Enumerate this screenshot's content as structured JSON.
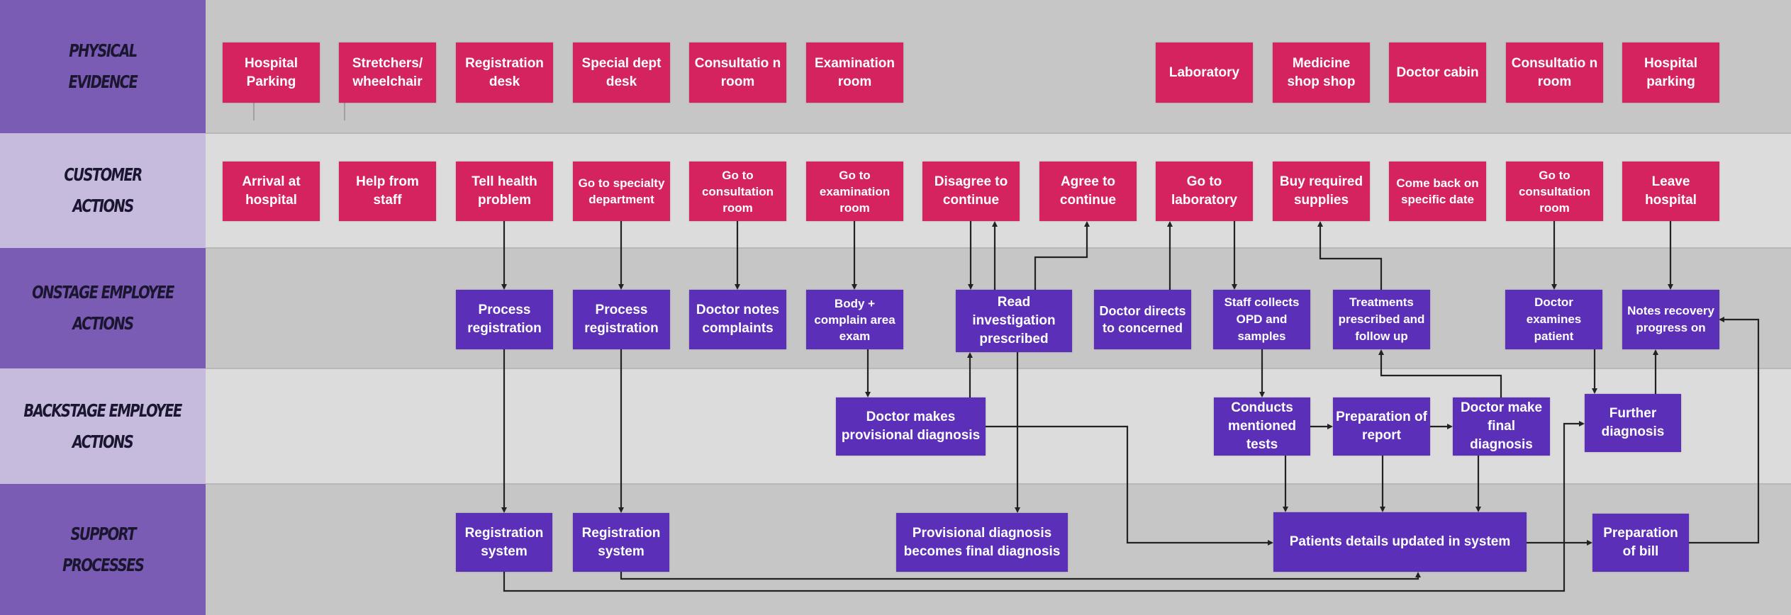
{
  "diagram": {
    "type": "service-blueprint",
    "colors": {
      "customer_facing_box": "#d4235f",
      "employee_process_box": "#5b2fb8",
      "lane_label_dark": "#7b5cb4",
      "lane_label_light": "#c6bbdc",
      "connector": "#222222"
    },
    "lanes": [
      {
        "id": "physical",
        "label": "Physical\nEvidence"
      },
      {
        "id": "customer",
        "label": "Customer\nActions"
      },
      {
        "id": "onstage",
        "label": "Onstage Employee\nActions"
      },
      {
        "id": "backstage",
        "label": "Backstage Employee\nActions"
      },
      {
        "id": "support",
        "label": "Support\nProcesses"
      }
    ],
    "physical_evidence": [
      "Hospital Parking",
      "Stretchers/ wheelchair",
      "Registration desk",
      "Special dept desk",
      "Consultatio n room",
      "Examination room",
      "Laboratory",
      "Medicine shop shop",
      "Doctor cabin",
      "Consultatio n room",
      "Hospital parking"
    ],
    "customer_actions": [
      "Arrival at hospital",
      "Help from staff",
      "Tell health problem",
      "Go to specialty department",
      "Go to consultation room",
      "Go to examination room",
      "Disagree to continue",
      "Agree to continue",
      "Go to laboratory",
      "Buy required supplies",
      "Come back on specific date",
      "Go to consultation room",
      "Leave hospital"
    ],
    "onstage_actions": [
      "Process registration",
      "Process registration",
      "Doctor notes complaints",
      "Body + complain area exam",
      "Read investigation prescribed",
      "Doctor directs to concerned",
      "Staff collects OPD and samples",
      "Treatments prescribed and follow up",
      "Doctor examines patient",
      "Notes recovery progress on"
    ],
    "backstage_actions": [
      "Doctor makes provisional diagnosis",
      "Conducts mentioned tests",
      "Preparation of report",
      "Doctor make final diagnosis",
      "Further diagnosis"
    ],
    "support_processes": [
      "Registration system",
      "Registration system",
      "Provisional diagnosis becomes final diagnosis",
      "Patients details updated in system",
      "Preparation of bill"
    ],
    "connections": [
      [
        "Tell health problem",
        "Process registration"
      ],
      [
        "Go to specialty department",
        "Process registration"
      ],
      [
        "Go to consultation room",
        "Doctor notes complaints"
      ],
      [
        "Go to examination room",
        "Body + complain area exam"
      ],
      [
        "Process registration",
        "Registration system"
      ],
      [
        "Process registration",
        "Registration system"
      ],
      [
        "Body + complain area exam",
        "Doctor makes provisional diagnosis"
      ],
      [
        "Doctor makes provisional diagnosis",
        "Read investigation prescribed"
      ],
      [
        "Disagree to continue",
        "Read investigation prescribed"
      ],
      [
        "Read investigation prescribed",
        "Disagree to continue"
      ],
      [
        "Read investigation prescribed",
        "Agree to continue"
      ],
      [
        "Read investigation prescribed",
        "Provisional diagnosis becomes final diagnosis"
      ],
      [
        "Doctor makes provisional diagnosis",
        "Patients details updated in system"
      ],
      [
        "Doctor directs to concerned",
        "Go to laboratory"
      ],
      [
        "Go to laboratory",
        "Staff collects OPD and samples"
      ],
      [
        "Staff collects OPD and samples",
        "Conducts mentioned tests"
      ],
      [
        "Conducts mentioned tests",
        "Preparation of report"
      ],
      [
        "Preparation of report",
        "Doctor make final diagnosis"
      ],
      [
        "Doctor make final diagnosis",
        "Treatments prescribed and follow up"
      ],
      [
        "Treatments prescribed and follow up",
        "Buy required supplies"
      ],
      [
        "Conducts mentioned tests",
        "Patients details updated in system"
      ],
      [
        "Preparation of report",
        "Patients details updated in system"
      ],
      [
        "Doctor make final diagnosis",
        "Patients details updated in system"
      ],
      [
        "Registration system",
        "Patients details updated in system"
      ],
      [
        "Registration system",
        "Further diagnosis"
      ],
      [
        "Go to consultation room",
        "Doctor examines patient"
      ],
      [
        "Doctor examines patient",
        "Further diagnosis"
      ],
      [
        "Further diagnosis",
        "Notes recovery progress on"
      ],
      [
        "Leave hospital",
        "Notes recovery progress on"
      ],
      [
        "Patients details updated in system",
        "Preparation of bill"
      ],
      [
        "Preparation of bill",
        "Notes recovery progress on"
      ]
    ]
  }
}
